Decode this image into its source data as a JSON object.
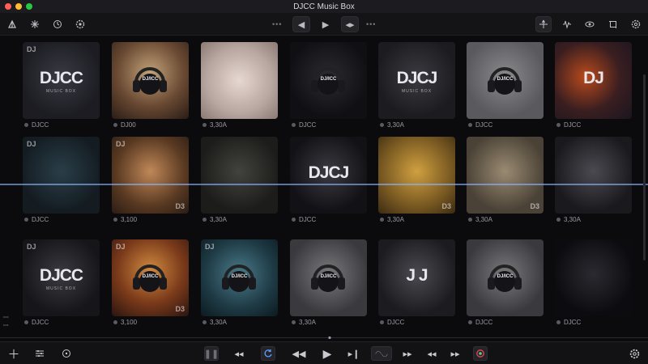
{
  "window": {
    "title": "DJCC Music Box"
  },
  "colors": {
    "close": "#ff5f57",
    "minimize": "#febc2e",
    "maximize": "#28c840",
    "wave_blue": "#3d7bff",
    "wave_purple": "#a46bff",
    "accent_record": "#e8455a"
  },
  "toolbar": {
    "left_icons": [
      "triangle-logo-icon",
      "sparkle-icon",
      "clock-icon",
      "gear-badge-icon"
    ],
    "center": {
      "prev_label": "◀",
      "play_label": "▶",
      "split_label": "◂▸"
    },
    "right_icons": [
      "pin-icon",
      "waveform-icon",
      "eye-icon",
      "crop-icon",
      "settings-icon"
    ]
  },
  "tiles": [
    {
      "caption": "DJCC",
      "corner": "DJ",
      "logo": "DJCC",
      "logo_sub": "MUSIC BOX"
    },
    {
      "caption": "DJ00",
      "hp_label": "DJ/ICC"
    },
    {
      "caption": "3,30A"
    },
    {
      "caption": "DJCC",
      "hp_label": "DJ/ICC"
    },
    {
      "caption": "3,30A",
      "logo": "DJCJ",
      "logo_sub": "MUSIC BOX"
    },
    {
      "caption": "DJCC",
      "hp_label": "DJ/ICC"
    },
    {
      "caption": "DJCC",
      "logo": "DJ"
    },
    {
      "caption": "DJCC",
      "corner": "DJ"
    },
    {
      "caption": "3,100",
      "corner": "DJ",
      "corner_br": "D3"
    },
    {
      "caption": "3,30A"
    },
    {
      "caption": "DJCC",
      "logo": "DJCJ"
    },
    {
      "caption": "3,30A",
      "corner_br": "D3"
    },
    {
      "caption": "3,30A",
      "corner_br": "D3"
    },
    {
      "caption": "3,30A"
    },
    {
      "caption": "DJCC",
      "corner": "DJ",
      "logo": "DJCC",
      "logo_sub": "MUSIC BOX"
    },
    {
      "caption": "3,100",
      "corner": "DJ",
      "corner_br": "D3",
      "hp_label": "DJ/ICC"
    },
    {
      "caption": "3,30A",
      "corner": "DJ",
      "hp_label": "DJ/ICC"
    },
    {
      "caption": "3,30A",
      "hp_label": "DJ/ICC"
    },
    {
      "caption": "DJCC",
      "logo": "J  J"
    },
    {
      "caption": "DJCC",
      "hp_label": "DJ/ICC"
    },
    {
      "caption": "DJCC"
    }
  ],
  "bottombar": {
    "left_icons": [
      "plus-icon",
      "equalizer-icon",
      "disc-icon"
    ],
    "transport": [
      "pause-icon",
      "rewind-icon",
      "loop-icon",
      "skip-back-icon",
      "play-icon",
      "skip-forward-icon",
      "crossfade-icon",
      "fast-forward-icon",
      "step-back-icon",
      "step-forward-icon",
      "record-icon"
    ],
    "right_icons": [
      "gear-icon"
    ]
  }
}
